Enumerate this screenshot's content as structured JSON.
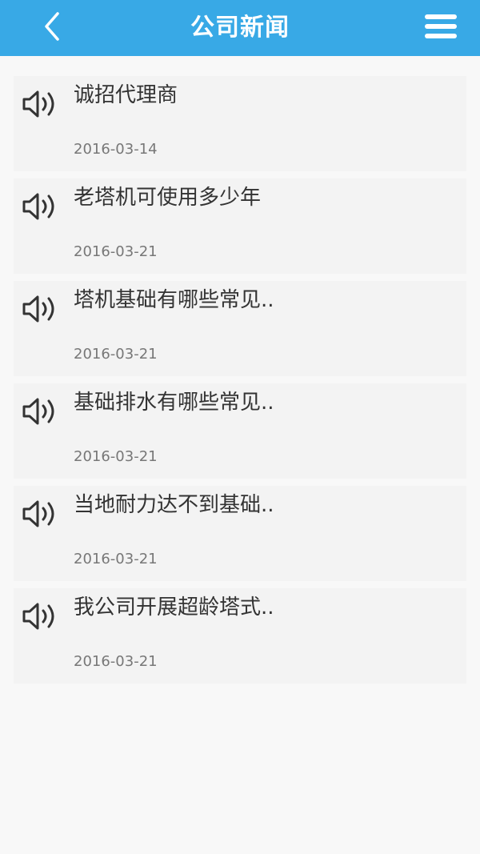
{
  "header": {
    "title": "公司新闻",
    "back_icon": "chevron-left-icon",
    "menu_icon": "hamburger-menu-icon",
    "color": "#38a9e6"
  },
  "news": [
    {
      "title": "诚招代理商",
      "date": "2016-03-14",
      "icon": "speaker-icon"
    },
    {
      "title": "老塔机可使用多少年",
      "date": "2016-03-21",
      "icon": "speaker-icon"
    },
    {
      "title": "塔机基础有哪些常见..",
      "date": "2016-03-21",
      "icon": "speaker-icon"
    },
    {
      "title": "基础排水有哪些常见..",
      "date": "2016-03-21",
      "icon": "speaker-icon"
    },
    {
      "title": "当地耐力达不到基础..",
      "date": "2016-03-21",
      "icon": "speaker-icon"
    },
    {
      "title": "我公司开展超龄塔式..",
      "date": "2016-03-21",
      "icon": "speaker-icon"
    }
  ]
}
